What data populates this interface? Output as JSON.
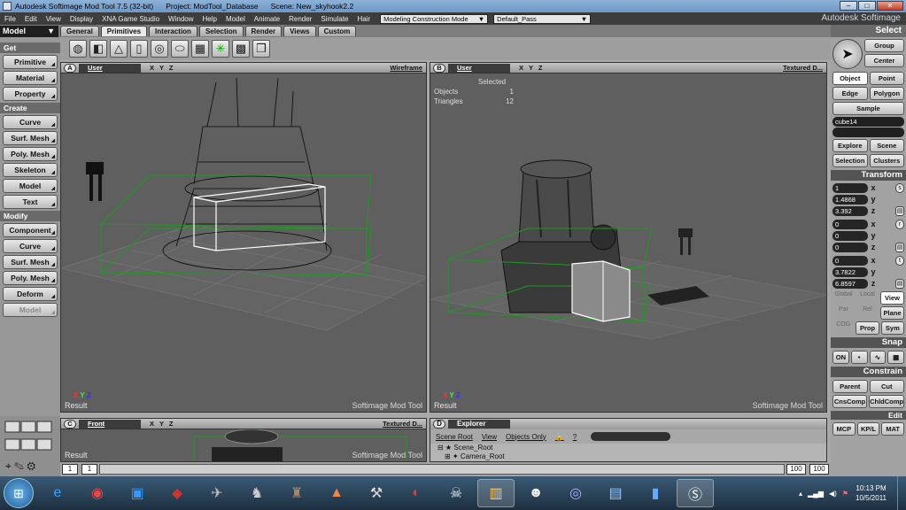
{
  "titlebar": {
    "app": "Autodesk Softimage Mod Tool 7.5 (32-bit)",
    "project": "Project: ModTool_Database",
    "scene": "Scene: New_skyhook2.2",
    "buttons": [
      "–",
      "□",
      "✕"
    ]
  },
  "menubar": {
    "items": [
      "File",
      "Edit",
      "View",
      "Display",
      "XNA Game Studio",
      "Window",
      "Help",
      "Model",
      "Animate",
      "Render",
      "Simulate",
      "Hair"
    ],
    "construction_mode": "Modeling Construction Mode",
    "pass": "Default_Pass",
    "brand": "Autodesk Softimage"
  },
  "modulebar": {
    "module": "Model",
    "tabs": [
      "General",
      "Primitives",
      "Interaction",
      "Selection",
      "Render",
      "Views",
      "Custom"
    ],
    "active_tab": "Primitives",
    "select_header": "Select"
  },
  "leftpanel": {
    "get_label": "Get",
    "get_items": [
      "Primitive",
      "Material",
      "Property"
    ],
    "create_label": "Create",
    "create_items": [
      "Curve",
      "Surf. Mesh",
      "Poly. Mesh",
      "Skeleton",
      "Model",
      "Text"
    ],
    "modify_label": "Modify",
    "modify_items": [
      "Component",
      "Curve",
      "Surf. Mesh",
      "Poly. Mesh",
      "Deform",
      "Model"
    ]
  },
  "viewports": {
    "a": {
      "letter": "A",
      "camera": "User",
      "mode": "Wireframe",
      "result": "Result",
      "watermark": "Softimage Mod Tool"
    },
    "b": {
      "letter": "B",
      "camera": "User",
      "mode": "Textured D...",
      "result": "Result",
      "watermark": "Softimage Mod Tool",
      "stats_title": "Selected",
      "objects_label": "Objects",
      "objects_value": "1",
      "triangles_label": "Triangles",
      "triangles_value": "12"
    },
    "c": {
      "letter": "C",
      "camera": "Front",
      "mode": "Textured D...",
      "result": "Result",
      "watermark": "Softimage Mod Tool"
    },
    "xyz": "X Y Z"
  },
  "explorer": {
    "letter": "D",
    "title": "Explorer",
    "tools": [
      "Scene Root",
      "View",
      "Objects Only"
    ],
    "tree": [
      "Scene_Root",
      "Camera_Root"
    ]
  },
  "timeline": {
    "start": "1",
    "current": "1",
    "end_a": "100",
    "end_b": "100"
  },
  "rightpanel": {
    "group": "Group",
    "center": "Center",
    "object": "Object",
    "point": "Point",
    "edge": "Edge",
    "polygon": "Polygon",
    "sample": "Sample",
    "selected_name": "cube14",
    "explore": "Explore",
    "scene": "Scene",
    "selection": "Selection",
    "clusters": "Clusters",
    "transform": "Transform",
    "scale": [
      "1",
      "1.4868",
      "3.392"
    ],
    "rotate": [
      "0",
      "0",
      "0"
    ],
    "translate": [
      "0",
      "3.7822",
      "6.8597"
    ],
    "global": "Global",
    "local": "Local",
    "view": "View",
    "par": "Par",
    "rel": "Rel",
    "plane": "Plane",
    "cog": "COG",
    "prop": "Prop",
    "sym": "Sym",
    "snap": "Snap",
    "on": "ON",
    "constrain": "Constrain",
    "parent": "Parent",
    "cut": "Cut",
    "cnscomp": "CnsComp",
    "chldcomp": "ChldComp",
    "edit": "Edit",
    "mcp": "MCP",
    "kpl": "KP/L",
    "mat": "MAT"
  },
  "taskbar": {
    "time": "10:13 PM",
    "date": "10/5/2011",
    "icons": [
      "ie-icon",
      "chrome-icon",
      "folder-icon",
      "app-icon",
      "game-icon",
      "game-icon",
      "game-icon",
      "app-icon",
      "tools-icon",
      "browser-icon",
      "game-icon",
      "explorer-icon",
      "game-icon",
      "media-icon",
      "app-icon",
      "phone-icon",
      "softimage-icon"
    ]
  }
}
